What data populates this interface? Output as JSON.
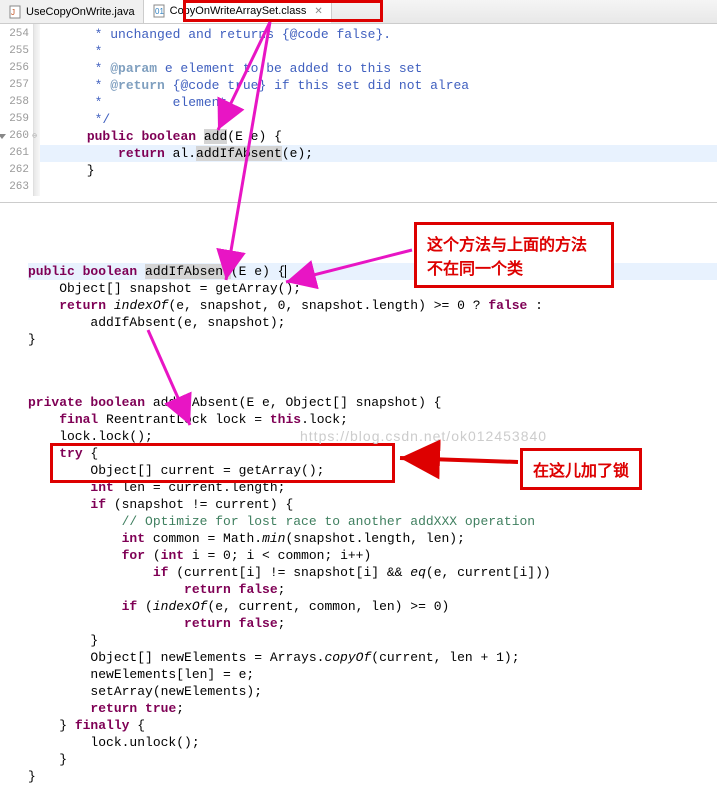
{
  "tabs": [
    {
      "label": "UseCopyOnWrite.java",
      "icon": "java-file"
    },
    {
      "label": "CopyOnWriteArraySet.class",
      "icon": "class-file",
      "active": true
    }
  ],
  "gutter": [
    "254",
    "255",
    "256",
    "257",
    "258",
    "259",
    "260",
    "261",
    "262",
    "263"
  ],
  "code1": {
    "l254a": "       ",
    "l254b": "* unchanged and returns ",
    "l254c": "{@code false}",
    "l254d": ".",
    "l255": "       *",
    "l256a": "       * ",
    "l256b": "@param",
    "l256c": " e element to be added to this set",
    "l257a": "       * ",
    "l257b": "@return",
    "l257c": " ",
    "l257d": "{@code true}",
    "l257e": " if this set did not alrea",
    "l258": "       *         element",
    "l259": "       */",
    "l260a": "      ",
    "l260b": "public",
    "l260c": " ",
    "l260d": "boolean",
    "l260e": " ",
    "l260f": "add",
    "l260g": "(E e) {",
    "l261a": "          ",
    "l261b": "return",
    "l261c": " al.",
    "l261d": "addIfAbsent",
    "l261e": "(e);",
    "l262": "      }",
    "l263": ""
  },
  "code2": {
    "l1a": "public",
    "l1b": " ",
    "l1c": "boolean",
    "l1d": " ",
    "l1e": "addIfAbsent",
    "l1f": "(E e) {",
    "l2": "    Object[] snapshot = getArray();",
    "l3a": "    ",
    "l3b": "return",
    "l3c": " ",
    "l3d": "indexOf",
    "l3e": "(e, snapshot, 0, snapshot.length) >= 0 ? ",
    "l3f": "false",
    "l3g": " :",
    "l4": "        addIfAbsent(e, snapshot);",
    "l5": "}"
  },
  "code3": {
    "l1a": "private",
    "l1b": " ",
    "l1c": "boolean",
    "l1d": " addIfAbsent(E e, Object[] snapshot) {",
    "l2a": "    ",
    "l2b": "final",
    "l2c": " ReentrantLock lock = ",
    "l2d": "this",
    "l2e": ".lock;",
    "l3": "    lock.lock();",
    "l4a": "    ",
    "l4b": "try",
    "l4c": " {",
    "l5": "        Object[] current = getArray();",
    "l6a": "        ",
    "l6b": "int",
    "l6c": " len = current.length;",
    "l7a": "        ",
    "l7b": "if",
    "l7c": " (snapshot != current) {",
    "l8a": "            ",
    "l8b": "// Optimize for lost race to another addXXX operation",
    "l9a": "            ",
    "l9b": "int",
    "l9c": " common = Math.",
    "l9d": "min",
    "l9e": "(snapshot.length, len);",
    "l10a": "            ",
    "l10b": "for",
    "l10c": " (",
    "l10d": "int",
    "l10e": " i = 0; i < common; i++)",
    "l11a": "                ",
    "l11b": "if",
    "l11c": " (current[i] != snapshot[i] && ",
    "l11d": "eq",
    "l11e": "(e, current[i]))",
    "l12a": "                    ",
    "l12b": "return",
    "l12c": " ",
    "l12d": "false",
    "l12e": ";",
    "l13a": "            ",
    "l13b": "if",
    "l13c": " (",
    "l13d": "indexOf",
    "l13e": "(e, current, common, len) >= 0)",
    "l14a": "                    ",
    "l14b": "return",
    "l14c": " ",
    "l14d": "false",
    "l14e": ";",
    "l15": "        }",
    "l16a": "        Object[] newElements = Arrays.",
    "l16b": "copyOf",
    "l16c": "(current, len + 1);",
    "l17": "        newElements[len] = e;",
    "l18": "        setArray(newElements);",
    "l19a": "        ",
    "l19b": "return",
    "l19c": " ",
    "l19d": "true",
    "l19e": ";",
    "l20a": "    } ",
    "l20b": "finally",
    "l20c": " {",
    "l21": "        lock.unlock();",
    "l22": "    }",
    "l23": "}"
  },
  "callout1_line1": "这个方法与上面的方法",
  "callout1_line2": "不在同一个类",
  "callout2": "在这儿加了锁",
  "watermark": "https://blog.csdn.net/ok012453840"
}
